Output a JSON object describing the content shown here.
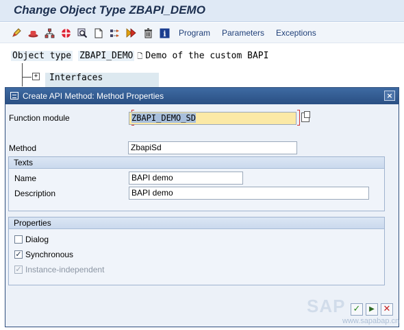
{
  "screen": {
    "title": "Change Object Type ZBAPI_DEMO",
    "toolbar": {
      "icons": [
        "edit-pencil-icon",
        "hat-icon",
        "network-icon",
        "test-icon",
        "magnifier-icon",
        "document-icon",
        "split-icon",
        "fast-forward-icon",
        "trash-icon",
        "info-icon"
      ],
      "buttons": [
        "Program",
        "Parameters",
        "Exceptions"
      ]
    },
    "tree": {
      "object_type_label": "Object type",
      "object_name": "ZBAPI_DEMO",
      "object_description": "Demo of the custom BAPI",
      "child_expander": "+",
      "child_label": "Interfaces"
    }
  },
  "dialog": {
    "title": "Create API Method: Method Properties",
    "close_glyph": "×",
    "function_module": {
      "label": "Function module",
      "value": "ZBAPI_DEMO_SD"
    },
    "method": {
      "label": "Method",
      "value": "ZbapiSd"
    },
    "texts": {
      "heading": "Texts",
      "name_label": "Name",
      "name_value": "BAPI demo",
      "description_label": "Description",
      "description_value": "BAPI demo"
    },
    "properties": {
      "heading": "Properties",
      "dialog": {
        "label": "Dialog",
        "checked": false
      },
      "synchronous": {
        "label": "Synchronous",
        "checked": true,
        "mark": "✓"
      },
      "instance_independent": {
        "label": "Instance-independent",
        "checked": true,
        "disabled": true,
        "mark": "✓"
      }
    },
    "footer": {
      "ok_glyph": "✓",
      "next_glyph": "▶",
      "cancel_glyph": "✕"
    },
    "watermark": {
      "logo": "SAP",
      "url": "www.sapabap.cn"
    }
  },
  "colors": {
    "title_bar": "#dfe9f5",
    "dialog_header": "#2a4f83",
    "required_field": "#fbe9a6",
    "required_bracket": "#d03030",
    "selection": "#a8bfdc",
    "toolbar_link": "#1f3f78"
  }
}
